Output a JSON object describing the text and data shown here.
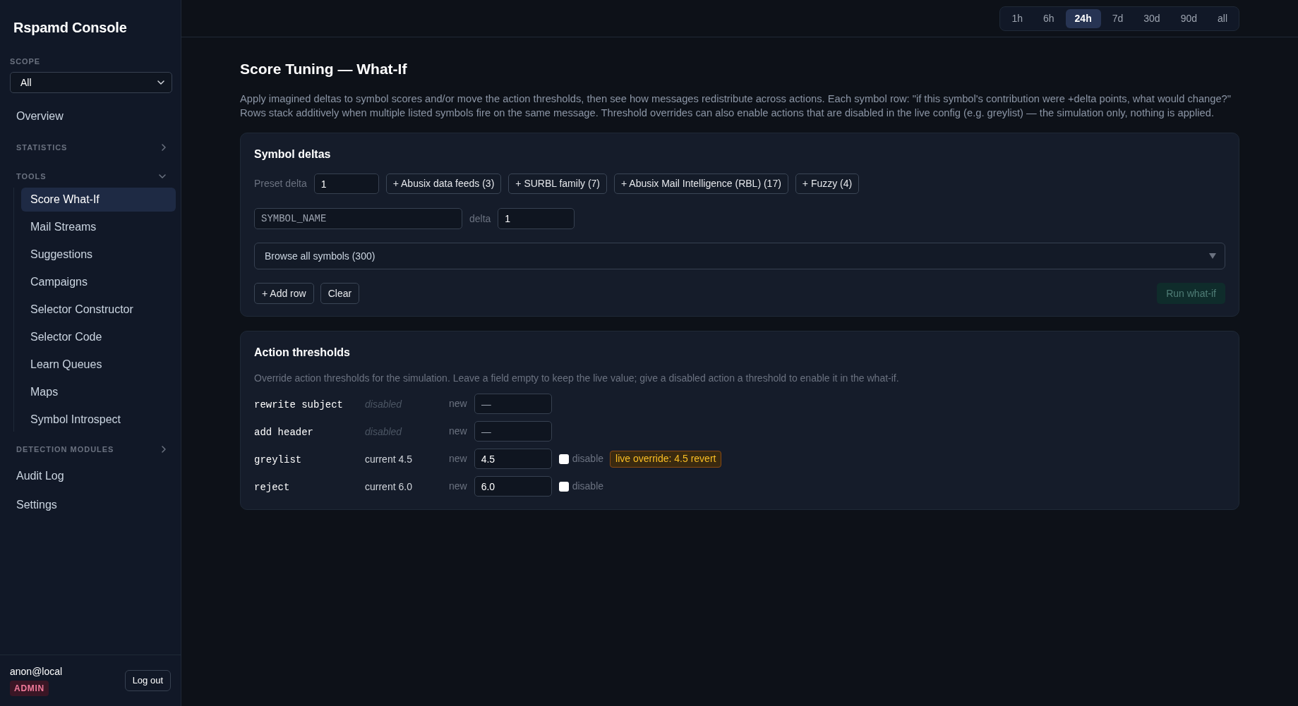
{
  "sidebar": {
    "title": "Rspamd Console",
    "scope": {
      "label": "SCOPE",
      "value": "All"
    },
    "nav": [
      {
        "kind": "link",
        "label": "Overview",
        "selected": false
      },
      {
        "kind": "group",
        "label": "STATISTICS",
        "expanded": false
      },
      {
        "kind": "group",
        "label": "TOOLS",
        "expanded": true,
        "children": [
          {
            "label": "Score What-If",
            "selected": true
          },
          {
            "label": "Mail Streams",
            "selected": false
          },
          {
            "label": "Suggestions",
            "selected": false
          },
          {
            "label": "Campaigns",
            "selected": false
          },
          {
            "label": "Selector Constructor",
            "selected": false
          },
          {
            "label": "Selector Code",
            "selected": false
          },
          {
            "label": "Learn Queues",
            "selected": false
          },
          {
            "label": "Maps",
            "selected": false
          },
          {
            "label": "Symbol Introspect",
            "selected": false
          }
        ]
      },
      {
        "kind": "group",
        "label": "DETECTION MODULES",
        "expanded": false
      },
      {
        "kind": "link",
        "label": "Audit Log",
        "selected": false
      },
      {
        "kind": "link",
        "label": "Settings",
        "selected": false
      }
    ],
    "user": {
      "name": "anon@local",
      "role": "ADMIN"
    },
    "logout": "Log out"
  },
  "range_tabs": [
    {
      "label": "1h",
      "selected": false
    },
    {
      "label": "6h",
      "selected": false
    },
    {
      "label": "24h",
      "selected": true
    },
    {
      "label": "7d",
      "selected": false
    },
    {
      "label": "30d",
      "selected": false
    },
    {
      "label": "90d",
      "selected": false
    },
    {
      "label": "all",
      "selected": false
    }
  ],
  "page": {
    "title": "Score Tuning — What-If",
    "description": "Apply imagined deltas to symbol scores and/or move the action thresholds, then see how messages redistribute across actions. Each symbol row: \"if this symbol's contribution were +delta points, what would change?\" Rows stack additively when multiple listed symbols fire on the same message. Threshold overrides can also enable actions that are disabled in the live config (e.g. greylist) — the simulation only, nothing is applied."
  },
  "symbol_deltas": {
    "title": "Symbol deltas",
    "preset": {
      "label": "Preset delta",
      "value": "1"
    },
    "presets": [
      "+ Abusix data feeds (3)",
      "+ SURBL family (7)",
      "+ Abusix Mail Intelligence (RBL) (17)",
      "+ Fuzzy (4)"
    ],
    "rows": [
      {
        "symbol_placeholder": "SYMBOL_NAME",
        "delta_label": "delta",
        "delta_value": "1"
      }
    ],
    "browse": "Browse all symbols (300)",
    "add_row": "+ Add row",
    "clear": "Clear",
    "run": {
      "label": "Run what-if",
      "disabled": true
    }
  },
  "action_thresholds": {
    "title": "Action thresholds",
    "description": "Override action thresholds for the simulation. Leave a field empty to keep the live value; give a disabled action a threshold to enable it in the what-if.",
    "rows": [
      {
        "name": "rewrite subject",
        "kind": "disabled",
        "status": "disabled",
        "new_label": "new",
        "placeholder": "—"
      },
      {
        "name": "add header",
        "kind": "disabled",
        "status": "disabled",
        "new_label": "new",
        "placeholder": "—"
      },
      {
        "name": "greylist",
        "kind": "active",
        "status": "current 4.5",
        "new_label": "new",
        "value": "4.5",
        "disable": {
          "label": "disable",
          "checked": false
        },
        "override": "live override: 4.5 revert"
      },
      {
        "name": "reject",
        "kind": "active",
        "status": "current 6.0",
        "new_label": "new",
        "value": "6.0",
        "disable": {
          "label": "disable",
          "checked": false
        }
      }
    ]
  }
}
